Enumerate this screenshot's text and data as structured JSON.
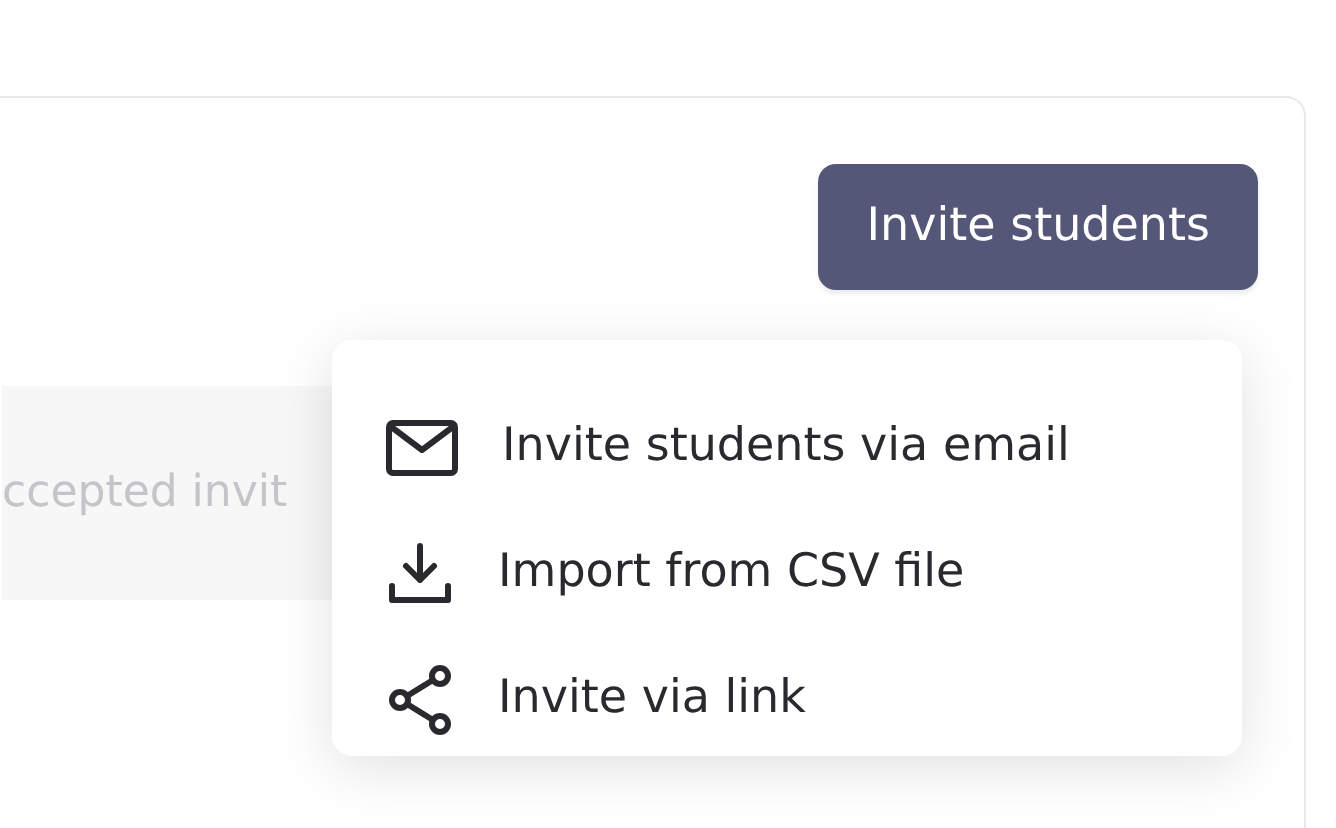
{
  "header": {
    "invite_button": "Invite students"
  },
  "tab_strip": {
    "label": "ccepted invit"
  },
  "invite_menu": {
    "items": [
      {
        "kind": "email",
        "label": "Invite students via email"
      },
      {
        "kind": "import",
        "label": "Import from CSV file"
      },
      {
        "kind": "share",
        "label": "Invite via link"
      }
    ]
  }
}
